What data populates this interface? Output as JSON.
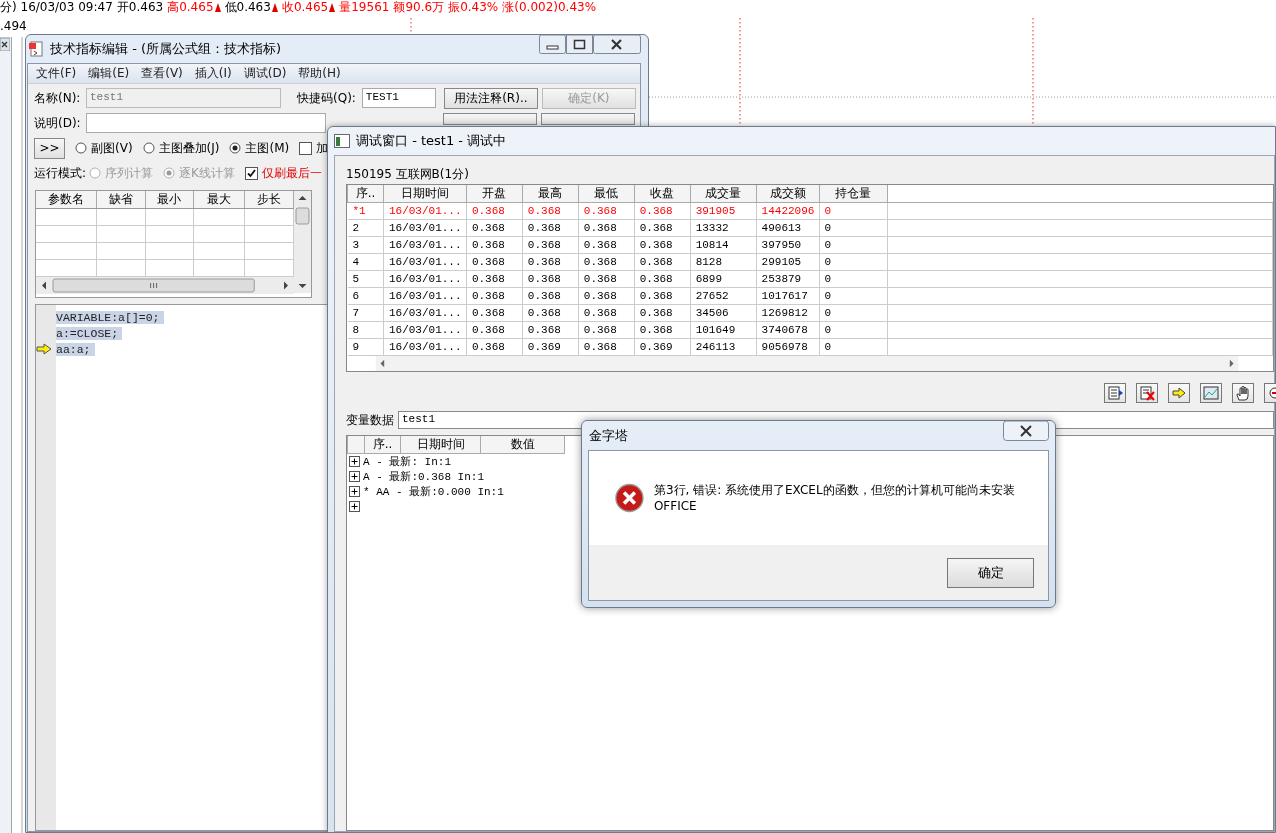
{
  "quote_bar": {
    "items": [
      {
        "text": "分) 16/03/03 09:47",
        "color": "#000000",
        "marker": false
      },
      {
        "text": "开0.463",
        "color": "#000000",
        "marker": false
      },
      {
        "text": "高0.465",
        "color": "#ff0000",
        "marker": true
      },
      {
        "text": "低0.463",
        "color": "#000000",
        "marker": true
      },
      {
        "text": "收0.465",
        "color": "#ff0000",
        "marker": true
      },
      {
        "text": "量19561",
        "color": "#ff0000",
        "marker": false
      },
      {
        "text": "额90.6万",
        "color": "#ff0000",
        "marker": false
      },
      {
        "text": "振0.43%",
        "color": "#ff0000",
        "marker": false
      },
      {
        "text": "涨(0.002)0.43%",
        "color": "#ff0000",
        "marker": false
      }
    ]
  },
  "chart": {
    "price_label": ".494"
  },
  "editor": {
    "title": "技术指标编辑 - (所属公式组：技术指标)",
    "menu": [
      "文件(F)",
      "编辑(E)",
      "查看(V)",
      "插入(I)",
      "调试(D)",
      "帮助(H)"
    ],
    "name_label": "名称(N):",
    "name_value": "test1",
    "hotkey_label": "快捷码(Q):",
    "hotkey_value": "TEST1",
    "buttons": [
      {
        "label": "用法注释(R)..",
        "disabled": false
      },
      {
        "label": "确定(K)",
        "disabled": true
      },
      {
        "disabled": false
      },
      {
        "disabled": false
      }
    ],
    "desc_label": "说明(D):",
    "expand_button": ">>",
    "chart_types": [
      {
        "label": "副图(V)",
        "selected": false
      },
      {
        "label": "主图叠加(J)",
        "selected": false
      },
      {
        "label": "主图(M)",
        "selected": true
      }
    ],
    "extra_checkbox": {
      "label": "加",
      "checked": false
    },
    "run_mode_label": "运行模式:",
    "run_modes": [
      {
        "label": "序列计算",
        "selected": false,
        "disabled": true
      },
      {
        "label": "逐K线计算",
        "selected": true,
        "disabled": true
      }
    ],
    "refresh_checkbox": {
      "label": "仅刷最后一",
      "checked": true
    },
    "param_columns": [
      "参数名",
      "缺省",
      "最小",
      "最大",
      "步长"
    ],
    "code_lines": [
      {
        "text": "VARIABLE:a[]=0;",
        "current": false
      },
      {
        "text": "a:=CLOSE;",
        "current": false
      },
      {
        "text": "aa:a;",
        "current": true
      }
    ]
  },
  "debug": {
    "title": "调试窗口  -  test1 - 调试中",
    "instrument": "150195 互联网B(1分)",
    "columns": [
      "序..",
      "日期时间",
      "开盘",
      "最高",
      "最低",
      "收盘",
      "成交量",
      "成交额",
      "持仓量"
    ],
    "rows": [
      {
        "selected": true,
        "cells": [
          "*1",
          "16/03/01...",
          "0.368",
          "0.368",
          "0.368",
          "0.368",
          "391905",
          "14422096",
          "0"
        ]
      },
      {
        "selected": false,
        "cells": [
          "2",
          "16/03/01...",
          "0.368",
          "0.368",
          "0.368",
          "0.368",
          "13332",
          "490613",
          "0"
        ]
      },
      {
        "selected": false,
        "cells": [
          "3",
          "16/03/01...",
          "0.368",
          "0.368",
          "0.368",
          "0.368",
          "10814",
          "397950",
          "0"
        ]
      },
      {
        "selected": false,
        "cells": [
          "4",
          "16/03/01...",
          "0.368",
          "0.368",
          "0.368",
          "0.368",
          "8128",
          "299105",
          "0"
        ]
      },
      {
        "selected": false,
        "cells": [
          "5",
          "16/03/01...",
          "0.368",
          "0.368",
          "0.368",
          "0.368",
          "6899",
          "253879",
          "0"
        ]
      },
      {
        "selected": false,
        "cells": [
          "6",
          "16/03/01...",
          "0.368",
          "0.368",
          "0.368",
          "0.368",
          "27652",
          "1017617",
          "0"
        ]
      },
      {
        "selected": false,
        "cells": [
          "7",
          "16/03/01...",
          "0.368",
          "0.368",
          "0.368",
          "0.368",
          "34506",
          "1269812",
          "0"
        ]
      },
      {
        "selected": false,
        "cells": [
          "8",
          "16/03/01...",
          "0.368",
          "0.368",
          "0.368",
          "0.368",
          "101649",
          "3740678",
          "0"
        ]
      },
      {
        "selected": false,
        "cells": [
          "9",
          "16/03/01...",
          "0.368",
          "0.369",
          "0.368",
          "0.369",
          "246113",
          "9056978",
          "0"
        ]
      }
    ],
    "var_label": "变量数据",
    "var_value": "test1",
    "var_columns": [
      "序..",
      "日期时间",
      "数值"
    ],
    "var_rows": [
      {
        "expanded": false,
        "text": "A  -  最新:  In:1"
      },
      {
        "expanded": false,
        "text": "A  -  最新:0.368  In:1"
      },
      {
        "expanded": false,
        "text": "* AA  -  最新:0.000  In:1"
      },
      {
        "expanded": false
      }
    ]
  },
  "dialog": {
    "title": "金字塔",
    "message": "第3行, 错误: 系统使用了EXCEL的函数，但您的计算机可能尚未安装OFFICE",
    "button": "确定"
  }
}
